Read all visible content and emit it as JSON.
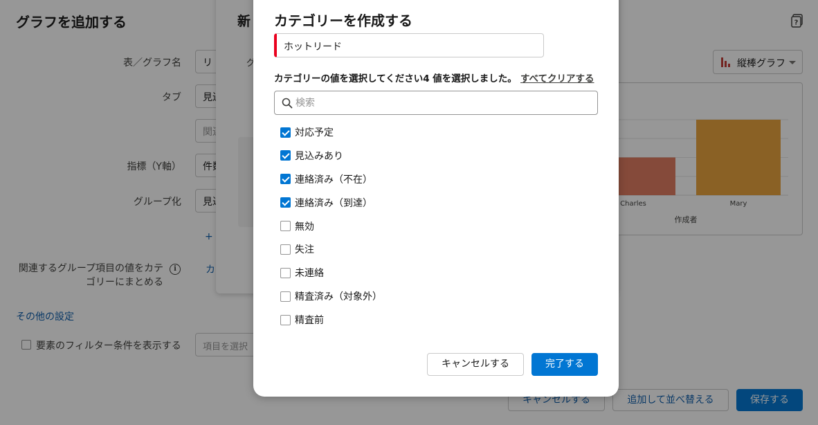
{
  "background": {
    "page_title": "グラフを追加する",
    "form": {
      "name_label": "表／グラフ名",
      "name_value": "リ",
      "tab_label": "タブ",
      "tab_value": "見過",
      "related_placeholder": "関連",
      "metric_label": "指標（Y軸）",
      "metric_value": "件数",
      "group_label": "グループ化",
      "group_value": "見込",
      "add_link": "+ フ",
      "merge_label_1": "関連するグループ項目の値をカテ",
      "merge_label_2": "ゴリーにまとめる",
      "merge_link": "カ",
      "other_settings": "その他の設定",
      "filter_checkbox_label": "要素のフィルター条件を表示する",
      "filter_select_placeholder": "項目を選択"
    },
    "mid_modal": {
      "title_fragment": "新",
      "sub_fragment": "グ"
    },
    "chart": {
      "type_select": "縦棒グラフ",
      "xlabel": "作成者"
    },
    "footer": {
      "cancel": "キャンセルする",
      "add_sort": "追加して並べ替える",
      "save": "保存する"
    }
  },
  "chart_data": {
    "type": "bar",
    "categories": [
      "Charles",
      "Mary"
    ],
    "values": [
      2,
      4
    ],
    "colors": [
      "#e07a5f",
      "#e9a23b"
    ],
    "xlabel": "作成者",
    "ylabel": "",
    "ylim": [
      0,
      4.4
    ],
    "grid": true,
    "partially_hidden": true
  },
  "modal": {
    "title": "カテゴリーを作成する",
    "category_name": "ホットリード",
    "select_prompt": "カテゴリーの値を選択してください",
    "selected_count": "4 値を選択しました。",
    "clear_all": "すべてクリアする",
    "search_placeholder": "検索",
    "options": [
      {
        "label": "対応予定",
        "checked": true
      },
      {
        "label": "見込みあり",
        "checked": true
      },
      {
        "label": "連絡済み（不在）",
        "checked": true
      },
      {
        "label": "連絡済み（到達）",
        "checked": true
      },
      {
        "label": "無効",
        "checked": false
      },
      {
        "label": "失注",
        "checked": false
      },
      {
        "label": "未連絡",
        "checked": false
      },
      {
        "label": "精査済み（対象外）",
        "checked": false
      },
      {
        "label": "精査前",
        "checked": false
      }
    ],
    "cancel_label": "キャンセルする",
    "done_label": "完了する"
  }
}
